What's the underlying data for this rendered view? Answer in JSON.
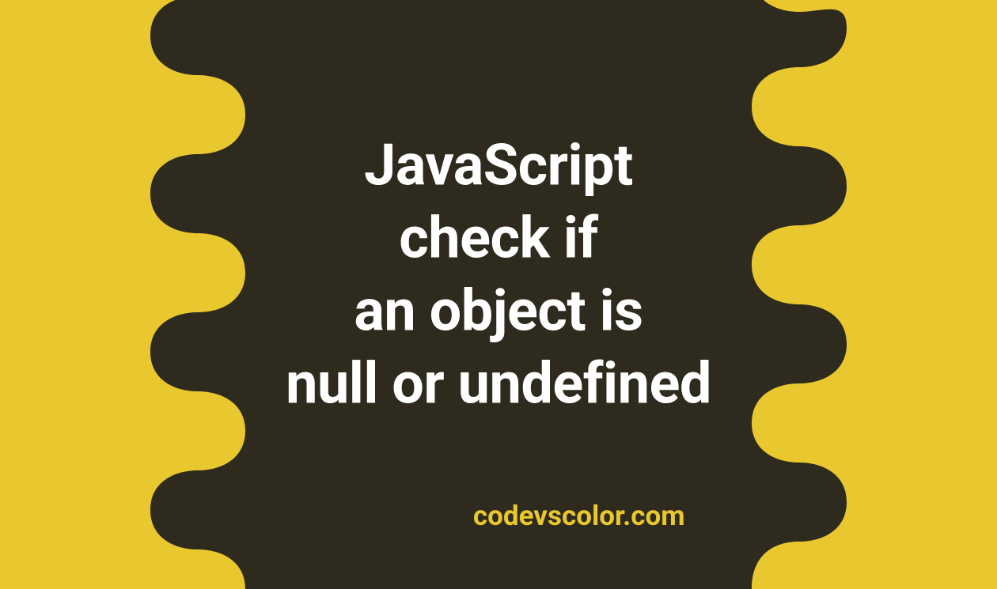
{
  "title": {
    "line1": "JavaScript",
    "line2": "check if",
    "line3": "an object is",
    "line4": "null or undefined"
  },
  "attribution": "codevscolor.com",
  "colors": {
    "background": "#e8c72f",
    "blob": "#2e2b1e",
    "title_text": "#ffffff",
    "attribution_text": "#e8c72f"
  }
}
